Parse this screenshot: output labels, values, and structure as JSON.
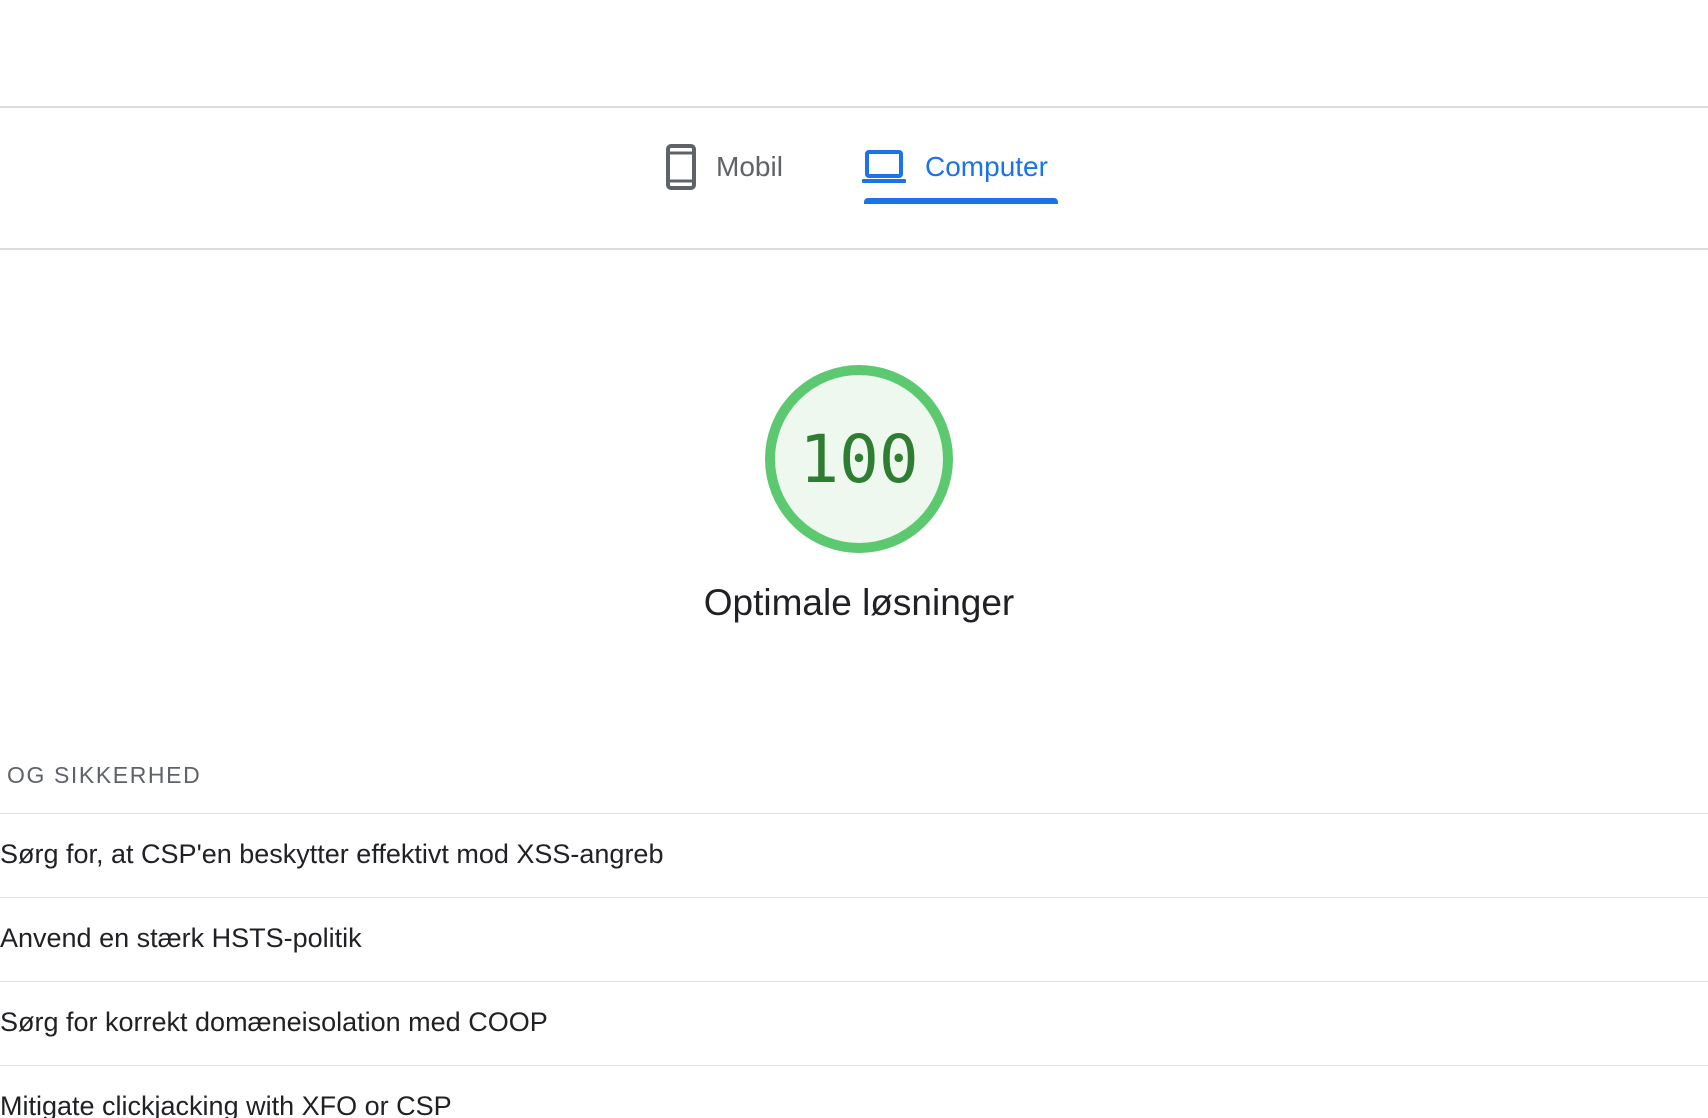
{
  "tabs": [
    {
      "label": "Mobil",
      "icon": "smartphone-icon",
      "active": false
    },
    {
      "label": "Computer",
      "icon": "laptop-icon",
      "active": true
    }
  ],
  "colors": {
    "accent": "#1a73e8",
    "score_ring": "#5cc971",
    "score_fill": "#eef8ef",
    "score_text": "#2e7d32"
  },
  "score": {
    "value": "100",
    "title": "Optimale løsninger"
  },
  "section": {
    "header": "OG SIKKERHED"
  },
  "audits": [
    {
      "label": "Sørg for, at CSP'en beskytter effektivt mod XSS-angreb"
    },
    {
      "label": "Anvend en stærk HSTS-politik"
    },
    {
      "label": "Sørg for korrekt domæneisolation med COOP"
    },
    {
      "label": "Mitigate clickjacking with XFO or CSP"
    }
  ]
}
